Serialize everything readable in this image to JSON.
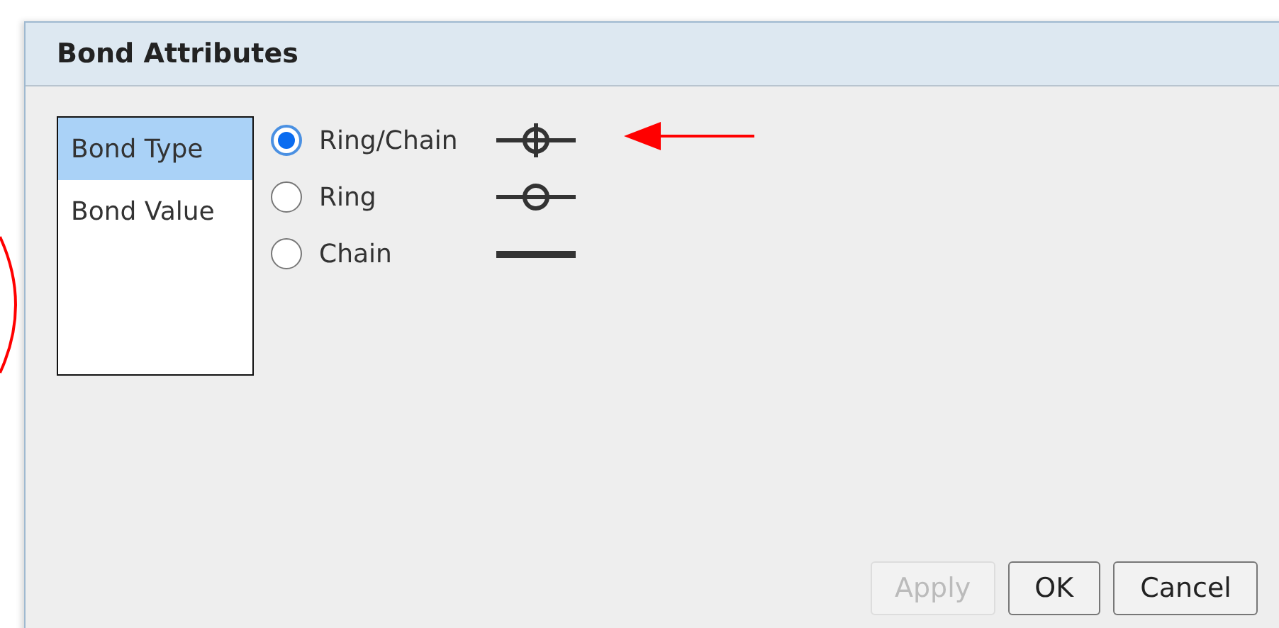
{
  "window": {
    "title": "Bond Attributes"
  },
  "categories": [
    {
      "label": "Bond Type",
      "selected": true
    },
    {
      "label": "Bond Value",
      "selected": false
    }
  ],
  "options": [
    {
      "label": "Ring/Chain",
      "selected": true,
      "kind": "ring_chain"
    },
    {
      "label": "Ring",
      "selected": false,
      "kind": "ring"
    },
    {
      "label": "Chain",
      "selected": false,
      "kind": "chain"
    }
  ],
  "buttons": [
    {
      "label": "Apply",
      "disabled": true
    },
    {
      "label": "OK",
      "disabled": false
    },
    {
      "label": "Cancel",
      "disabled": false
    }
  ]
}
